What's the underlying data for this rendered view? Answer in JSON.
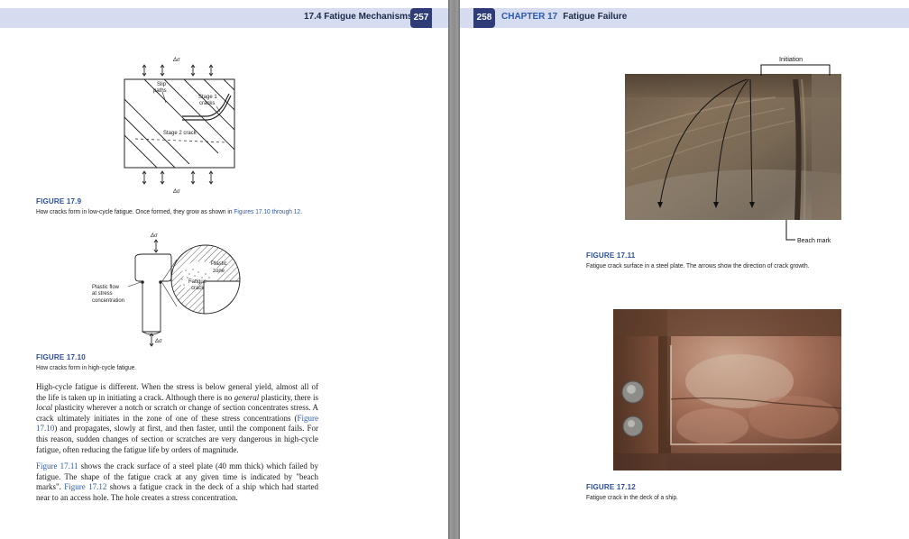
{
  "left_page": {
    "header_title": "17.4 Fatigue Mechanisms",
    "page_number": "257",
    "fig_9": {
      "label": "FIGURE 17.9",
      "caption_a": "How cracks form in low-cycle fatigue. Once formed, they grow as shown in ",
      "caption_ref": "Figures 17.10 through 12",
      "caption_b": ".",
      "delta_sigma": "Δσ",
      "slip_paths": [
        "Slip",
        "paths"
      ],
      "stage1": [
        "Stage 1",
        "cracks"
      ],
      "stage2": "Stage 2 crack"
    },
    "fig_10": {
      "label": "FIGURE 17.10",
      "caption": "How cracks form in high-cycle fatigue.",
      "delta_sigma": "Δσ",
      "plastic_flow": [
        "Plastic flow",
        "at stress",
        "concentration"
      ],
      "plastic_zone": [
        "Plastic",
        "zone"
      ],
      "fatigue_crack": [
        "Fatigue",
        "crack"
      ]
    },
    "para1": {
      "a": "High-cycle fatigue is different. When the stress is below general yield, almost all of the life is taken up in initiating a crack. Although there is no ",
      "em1": "general",
      "b": " plasticity, there is ",
      "em2": "local",
      "c": " plasticity wherever a notch or scratch or change of section concentrates stress. A crack ultimately initiates in the zone of one of these stress concentrations (",
      "ref": "Figure 17.10",
      "d": ") and propagates, slowly at first, and then faster, until the component fails. For this reason, sudden changes of section or scratches are very dangerous in high-cycle fatigue, often reducing the fatigue life by orders of magnitude."
    },
    "para2": {
      "ref1": "Figure 17.11",
      "a": " shows the crack surface of a steel plate (40 mm thick) which failed by fatigue. The shape of the fatigue crack at any given time is indicated by \"beach marks\". ",
      "ref2": "Figure 17.12",
      "b": " shows a fatigue crack in the deck of a ship which had started near to an access hole. The hole creates a stress concentration."
    }
  },
  "right_page": {
    "page_number": "258",
    "chapter_label": "CHAPTER 17",
    "chapter_title": "Fatigue Failure",
    "fig_11": {
      "label": "FIGURE 17.11",
      "caption": "Fatigue crack surface in a steel plate. The arrows show the direction of crack growth.",
      "initiation": "Initiation",
      "beach_mark": "Beach mark"
    },
    "fig_12": {
      "label": "FIGURE 17.12",
      "caption": "Fatigue crack in the deck of a ship."
    }
  },
  "colors": {
    "header_band": "#d6dcef",
    "page_number_tab": "#2e3d78",
    "figure_label": "#2e4d9a",
    "link": "#2e5aa8"
  }
}
